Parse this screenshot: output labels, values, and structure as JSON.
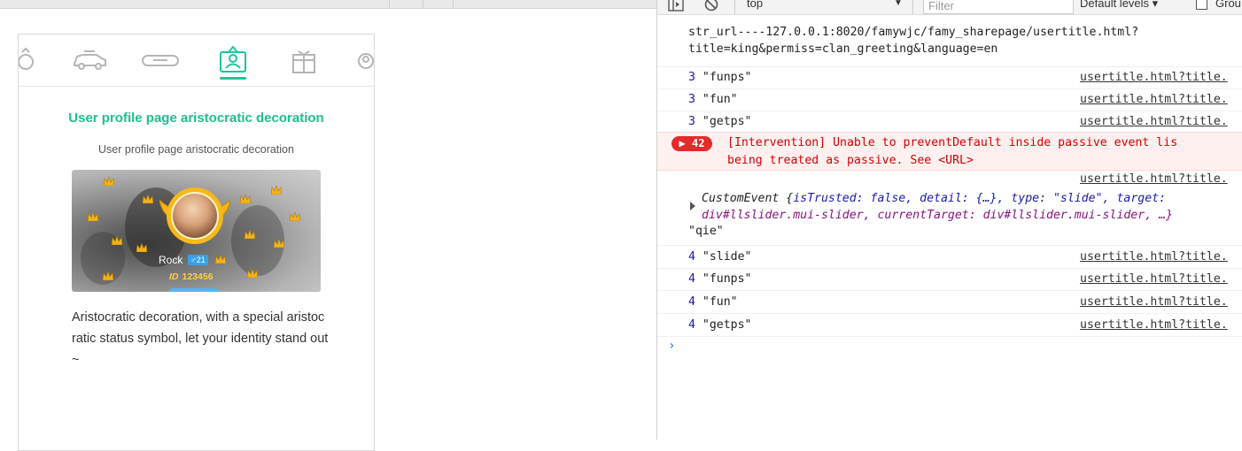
{
  "preview": {
    "section_title": "User profile page aristocratic decoration",
    "section_subtitle": "User profile page aristocratic decoration",
    "user_name": "Rock",
    "gender_badge": "♂21",
    "id_label": "ID",
    "id_value": "123456",
    "description": "Aristocratic decoration, with a special aristocratic status symbol, let your identity stand out~",
    "tab_icons": [
      "ring-icon",
      "car-icon",
      "bubble-icon",
      "badge-icon",
      "gift-icon",
      "avatar-frame-icon"
    ],
    "accent_color": "#1dbf8f"
  },
  "devtools": {
    "toolbar": {
      "context": "top",
      "filter_placeholder": "Filter",
      "levels": "Default levels ▾",
      "group": "Grou"
    },
    "log": {
      "url_line1": "str_url----127.0.0.1:8020/famywjc/famy_sharepage/usertitle.html?",
      "url_line2": "title=king&permiss=clan_greeting&language=en",
      "source": "usertitle.html?title.",
      "rows_a": [
        {
          "count": "3",
          "value": "\"funps\""
        },
        {
          "count": "3",
          "value": "\"fun\""
        },
        {
          "count": "3",
          "value": "\"getps\""
        }
      ],
      "error": {
        "count": "42",
        "line1": "[Intervention] Unable to preventDefault inside passive event lis",
        "line2": "being treated as passive. See <URL>"
      },
      "event_line1_prefix": "CustomEvent {",
      "event_line1": "isTrusted: false, detail: {…}, type: \"slide\", target:",
      "event_line2": "div#llslider.mui-slider, currentTarget: div#llslider.mui-slider, …}",
      "event_qie": "\"qie\"",
      "rows_b": [
        {
          "count": "4",
          "value": "\"slide\""
        },
        {
          "count": "4",
          "value": "\"funps\""
        },
        {
          "count": "4",
          "value": "\"fun\""
        },
        {
          "count": "4",
          "value": "\"getps\""
        }
      ],
      "prompt": "›"
    }
  }
}
